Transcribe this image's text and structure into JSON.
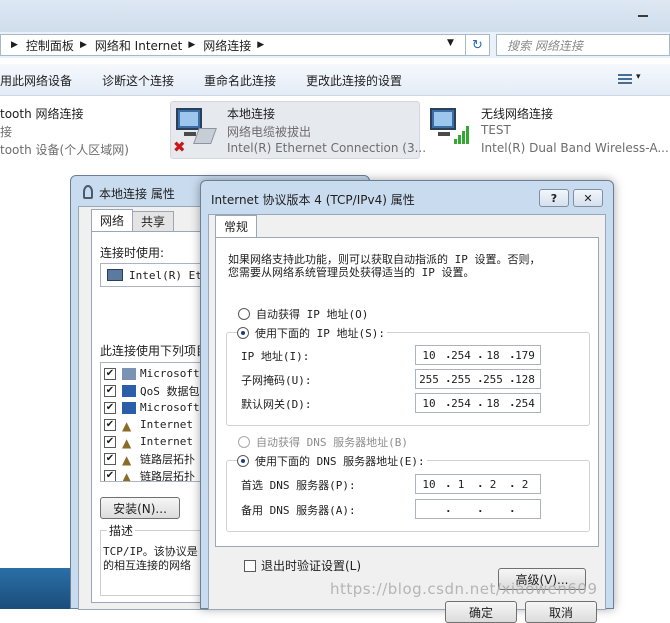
{
  "explorer": {
    "breadcrumbs": [
      "控制面板",
      "网络和 Internet",
      "网络连接"
    ],
    "search_placeholder": "搜索 网络连接",
    "toolbar": [
      "用此网络设备",
      "诊断这个连接",
      "重命名此连接",
      "更改此连接的设置"
    ]
  },
  "adapters": [
    {
      "name": "tooth 网络连接",
      "status": "接",
      "device": "tooth 设备(个人区域网)"
    },
    {
      "name": "本地连接",
      "status": "网络电缆被拔出",
      "device": "Intel(R) Ethernet Connection (3..."
    },
    {
      "name": "无线网络连接",
      "status": "TEST",
      "device": "Intel(R) Dual Band Wireless-A..."
    }
  ],
  "back_dialog": {
    "title": "本地连接 属性",
    "tabs": [
      "网络",
      "共享"
    ],
    "connect_using_label": "连接时使用:",
    "adapter_value": "Intel(R) Eth",
    "components_label": "此连接使用下列项目",
    "components": [
      "Microsoft",
      "QoS 数据包",
      "Microsoft",
      "Internet",
      "Internet",
      "链路层拓扑",
      "链路层拓扑"
    ],
    "install_button": "安装(N)...",
    "desc_label": "描述",
    "desc_text_1": "TCP/IP。该协议是",
    "desc_text_2": "的相互连接的网络"
  },
  "ipv4_dialog": {
    "title": "Internet 协议版本 4 (TCP/IPv4) 属性",
    "help_btn": "?",
    "close_btn": "✕",
    "tab": "常规",
    "intro_1": "如果网络支持此功能，则可以获取自动指派的 IP 设置。否则，",
    "intro_2": "您需要从网络系统管理员处获得适当的 IP 设置。",
    "auto_ip": "自动获得 IP 地址(O)",
    "manual_ip": "使用下面的 IP 地址(S):",
    "ip_label": "IP 地址(I):",
    "ip_value": [
      "10",
      "254",
      "18",
      "179"
    ],
    "mask_label": "子网掩码(U):",
    "mask_value": [
      "255",
      "255",
      "255",
      "128"
    ],
    "gateway_label": "默认网关(D):",
    "gateway_value": [
      "10",
      "254",
      "18",
      "254"
    ],
    "auto_dns": "自动获得 DNS 服务器地址(B)",
    "manual_dns": "使用下面的 DNS 服务器地址(E):",
    "dns1_label": "首选 DNS 服务器(P):",
    "dns1_value": [
      "10",
      "1",
      "2",
      "2"
    ],
    "dns2_label": "备用 DNS 服务器(A):",
    "dns2_value": [
      "",
      "",
      "",
      ""
    ],
    "validate_label": "退出时验证设置(L)",
    "advanced_button": "高级(V)...",
    "ok_button": "确定",
    "cancel_button": "取消"
  },
  "watermark": "https://blog.csdn.net/xiaowen609"
}
